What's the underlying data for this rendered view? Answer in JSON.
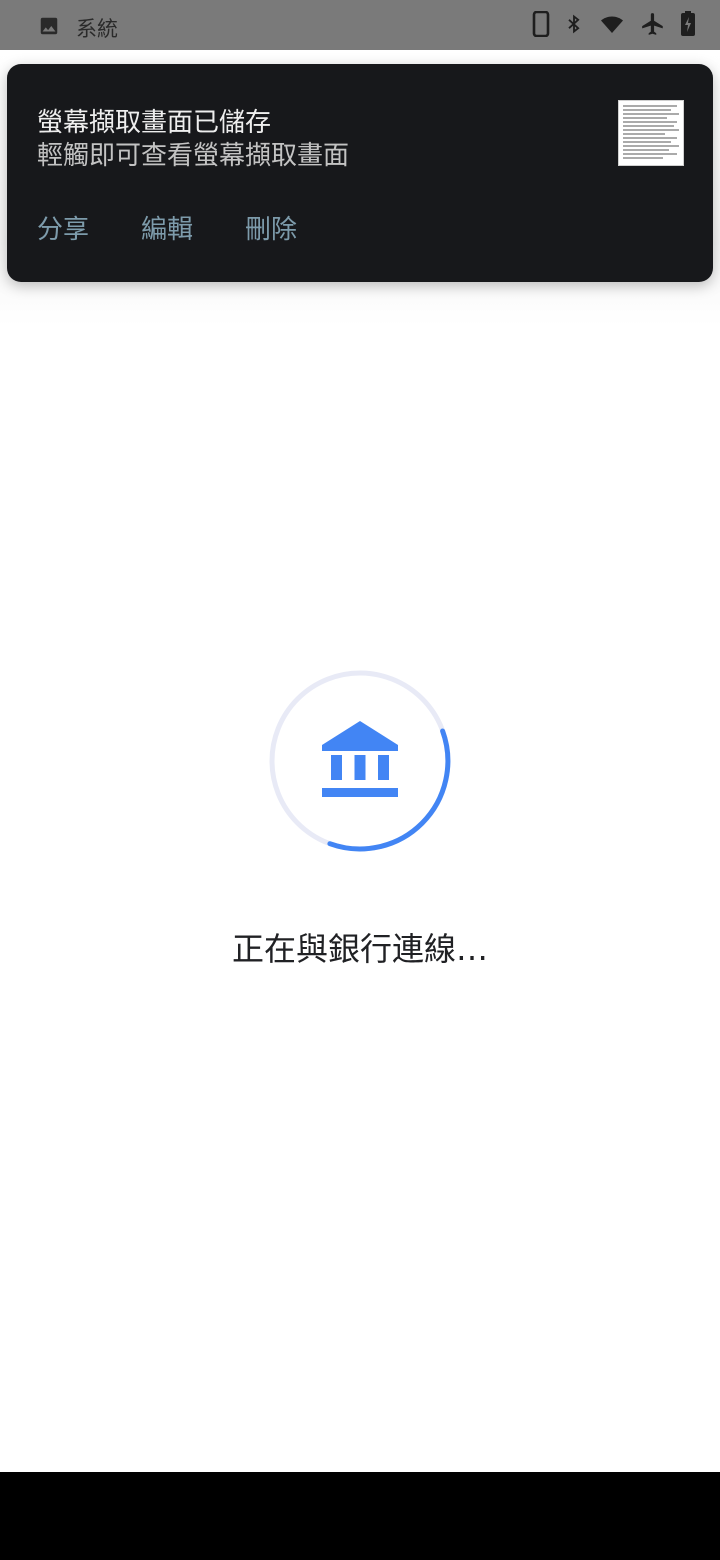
{
  "status_bar": {
    "app_label": "系統",
    "left_icon": "image-icon",
    "right_icons": [
      "phone-icon",
      "bluetooth-icon",
      "wifi-icon",
      "airplane-icon",
      "battery-icon"
    ]
  },
  "notification": {
    "title": "螢幕擷取畫面已儲存",
    "text": "輕觸即可查看螢幕擷取畫面",
    "actions": [
      "分享",
      "編輯",
      "刪除"
    ]
  },
  "main": {
    "icon": "bank-icon",
    "status_text": "正在與銀行連線…",
    "accent_color": "#4285f4",
    "track_color": "#e8eaf6"
  }
}
